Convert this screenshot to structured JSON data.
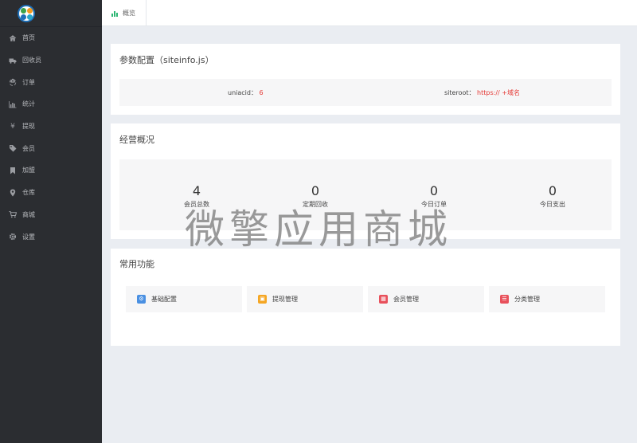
{
  "sidebar": {
    "items": [
      {
        "label": "首页",
        "icon": "home-icon"
      },
      {
        "label": "回收员",
        "icon": "truck-icon"
      },
      {
        "label": "订单",
        "icon": "recycle-icon"
      },
      {
        "label": "统计",
        "icon": "bar-chart-icon"
      },
      {
        "label": "提现",
        "icon": "yen-icon"
      },
      {
        "label": "会员",
        "icon": "tag-icon"
      },
      {
        "label": "加盟",
        "icon": "bookmark-icon"
      },
      {
        "label": "仓库",
        "icon": "map-marker-icon"
      },
      {
        "label": "商城",
        "icon": "cart-icon"
      },
      {
        "label": "设置",
        "icon": "gear-icon"
      }
    ]
  },
  "topbar": {
    "breadcrumb": "概览"
  },
  "param_config": {
    "title": "参数配置（siteinfo.js）",
    "uniacid_label": "uniacid：",
    "uniacid_value": "6",
    "siteroot_label": "siteroot：",
    "siteroot_value": "https:// +域名"
  },
  "operations": {
    "title": "经营概况",
    "stats": [
      {
        "value": "4",
        "label": "会员总数"
      },
      {
        "value": "0",
        "label": "定期回收"
      },
      {
        "value": "0",
        "label": "今日订单"
      },
      {
        "value": "0",
        "label": "今日支出"
      }
    ]
  },
  "functions": {
    "title": "常用功能",
    "tiles": [
      {
        "label": "基础配置",
        "icon": "settings-icon",
        "color": "#4a90e2"
      },
      {
        "label": "提现管理",
        "icon": "wallet-icon",
        "color": "#f5a623"
      },
      {
        "label": "会员管理",
        "icon": "calendar-icon",
        "color": "#e8505b"
      },
      {
        "label": "分类管理",
        "icon": "list-icon",
        "color": "#e8505b"
      }
    ]
  },
  "watermark": "微擎应用商城",
  "colors": {
    "sidebar_bg": "#2b2d31",
    "page_bg": "#eaedf2",
    "accent_red": "#e53935",
    "breadcrumb_icon": "#2bb673"
  }
}
